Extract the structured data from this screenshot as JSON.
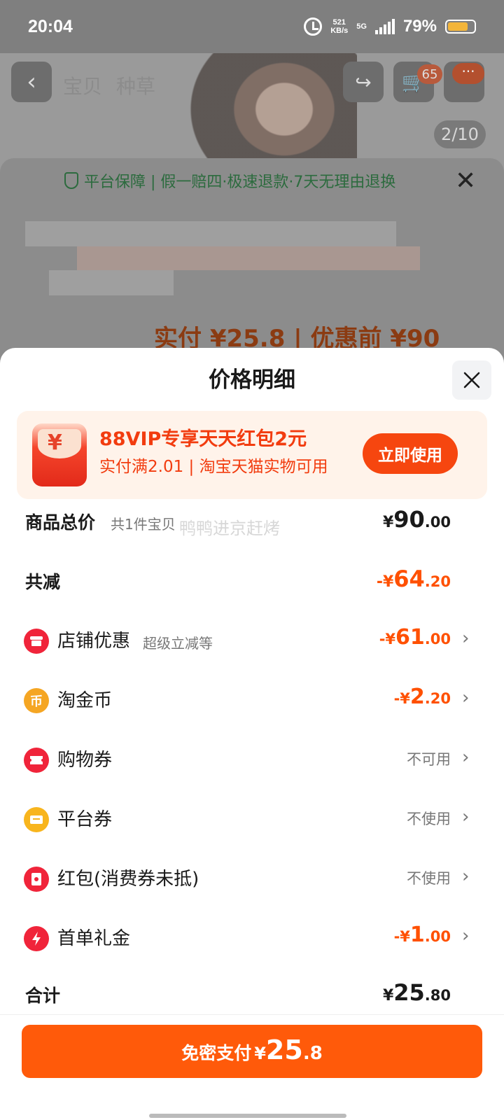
{
  "status_bar": {
    "time": "20:04",
    "net_speed_value": "521",
    "net_speed_unit": "KB/s",
    "network": "5G",
    "battery": "79%",
    "battery_level": 0.79,
    "alarm_icon": "alarm-clock-icon"
  },
  "product_page": {
    "tabs": [
      "宝贝",
      "种草"
    ],
    "cart_badge": "65",
    "more_badge": "···",
    "image_counter": "2/10",
    "guarantee_text": "平台保障 | 假一赔四·极速退款·7天无理由退换",
    "blurred_price_text": "实付 ¥25.8 | 优惠前 ¥90"
  },
  "sheet": {
    "title": "价格明细",
    "promo": {
      "title": "88VIP专享天天红包2元",
      "subtitle": "实付满2.01 | 淘宝天猫实物可用",
      "button": "立即使用",
      "icon_glyph": "¥"
    },
    "watermark": "鸭鸭进京赶烤",
    "total_goods": {
      "label": "商品总价",
      "sub": "共1件宝贝",
      "yen": "¥",
      "int": "90",
      "dec": ".00"
    },
    "total_discount": {
      "label": "共减",
      "yen": "-¥",
      "int": "64",
      "dec": ".20"
    },
    "items": [
      {
        "label": "店铺优惠",
        "sub": "超级立减等",
        "yen": "-¥",
        "int": "61",
        "dec": ".00",
        "icon": "store-icon",
        "color": "#f0243a"
      },
      {
        "label": "淘金币",
        "yen": "-¥",
        "int": "2",
        "dec": ".20",
        "icon": "coin-icon",
        "color": "#f5a623",
        "glyph": "币"
      },
      {
        "label": "购物券",
        "status": "不可用",
        "icon": "ticket-icon",
        "color": "#f0243a"
      },
      {
        "label": "平台券",
        "status": "不使用",
        "icon": "coupon-icon",
        "color": "#f8b51d"
      },
      {
        "label": "红包(消费券未抵)",
        "status": "不使用",
        "icon": "red-packet-icon",
        "color": "#f0243a"
      },
      {
        "label": "首单礼金",
        "yen": "-¥",
        "int": "1",
        "dec": ".00",
        "icon": "lightning-icon",
        "color": "#f0243a"
      }
    ],
    "grand_total": {
      "label": "合计",
      "yen": "¥",
      "int": "25",
      "dec": ".80"
    },
    "pay_button": {
      "label": "免密支付",
      "yen": "¥",
      "int": "25",
      "dec": ".8"
    }
  },
  "colors": {
    "accent": "#ff5000",
    "pay_button": "#ff5a0a",
    "promo_bg": "#fff3ea"
  }
}
